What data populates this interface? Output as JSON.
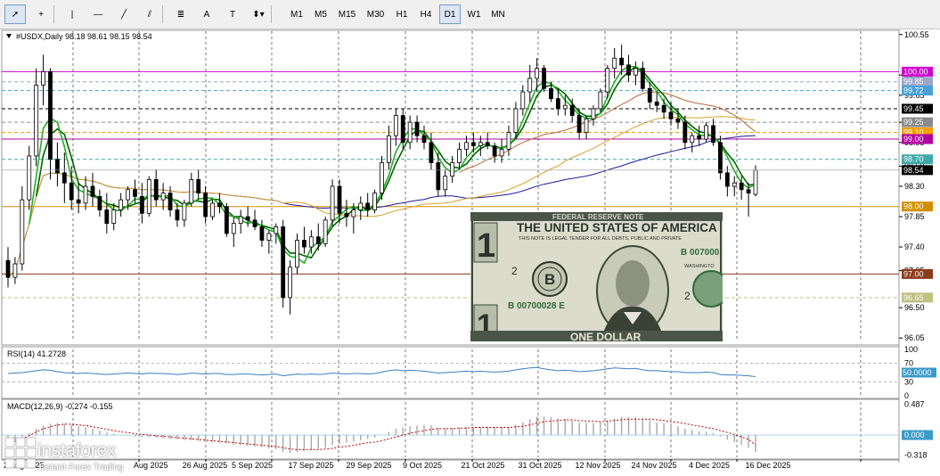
{
  "toolbar": {
    "tools": [
      {
        "name": "cursor-icon",
        "glyph": "➚",
        "selected": true
      },
      {
        "name": "crosshair-icon",
        "glyph": "+"
      },
      {
        "name": "vertical-line-icon",
        "glyph": "|"
      },
      {
        "name": "horizontal-line-icon",
        "glyph": "—"
      },
      {
        "name": "trendline-icon",
        "glyph": "╱"
      },
      {
        "name": "equidistant-channel-icon",
        "glyph": "⫽"
      },
      {
        "name": "fibonacci-icon",
        "glyph": "≣"
      },
      {
        "name": "text-icon",
        "glyph": "A"
      },
      {
        "name": "text-label-icon",
        "glyph": "T"
      },
      {
        "name": "arrows-icon",
        "glyph": "⬍▾"
      }
    ],
    "timeframes": [
      "M1",
      "M5",
      "M15",
      "M30",
      "H1",
      "H4",
      "D1",
      "W1",
      "MN"
    ],
    "active_timeframe": "D1"
  },
  "chart_data": [
    {
      "type": "candlestick",
      "title": "#USDX,Daily",
      "ohlc_header": "98.18 98.61 98.15 98.54",
      "x_labels": [
        "26 Aug 2025",
        "5 Sep 2025",
        "17 Sep 2025",
        "29 Sep 2025",
        "9 Oct 2025",
        "21 Oct 2025",
        "31 Oct 2025",
        "12 Nov 2025",
        "24 Nov 2025",
        "4 Dec 2025",
        "16 Dec 2025"
      ],
      "x_partial_labels": [
        "2 Aug 2025",
        "Aug 2025"
      ],
      "y_ticks": [
        100.55,
        99.95,
        99.65,
        99.25,
        98.95,
        98.6,
        98.3,
        97.85,
        97.4,
        97.05,
        96.5,
        96.05
      ],
      "ylim": [
        96.0,
        100.6
      ],
      "price_levels": [
        {
          "value": 100.0,
          "label": "100.00",
          "color": "#d000d0",
          "style": "solid"
        },
        {
          "value": 99.85,
          "label": "99.85",
          "color": "#9aa6c8",
          "style": "dashed"
        },
        {
          "value": 99.72,
          "label": "99.72",
          "color": "#4aa0d8",
          "style": "dashed"
        },
        {
          "value": 99.45,
          "label": "99.45",
          "color": "#000000",
          "style": "dashed"
        },
        {
          "value": 99.25,
          "label": "99.25",
          "color": "#8a8a8a",
          "style": "dashed"
        },
        {
          "value": 99.1,
          "label": "99.10",
          "color": "#f0a000",
          "style": "dashed"
        },
        {
          "value": 99.0,
          "label": "99.00",
          "color": "#b000a0",
          "style": "solid"
        },
        {
          "value": 98.7,
          "label": "98.70",
          "color": "#40a8a8",
          "style": "dashed"
        },
        {
          "value": 98.0,
          "label": "98.00",
          "color": "#d09000",
          "style": "solid"
        },
        {
          "value": 97.0,
          "label": "97.00",
          "color": "#8b3a1a",
          "style": "solid"
        },
        {
          "value": 96.65,
          "label": "96.65",
          "color": "#c0c080",
          "style": "dashed"
        }
      ],
      "current_price": {
        "value": 98.54,
        "label": "98.54",
        "color": "#000000"
      },
      "candles": [
        [
          97.2,
          97.4,
          96.8,
          96.95
        ],
        [
          96.95,
          97.25,
          96.85,
          97.15
        ],
        [
          97.15,
          98.3,
          97.05,
          98.1
        ],
        [
          98.1,
          98.9,
          97.95,
          98.75
        ],
        [
          98.75,
          100.05,
          98.6,
          99.8
        ],
        [
          99.8,
          100.25,
          99.5,
          100.0
        ],
        [
          100.0,
          100.05,
          98.4,
          98.7
        ],
        [
          98.7,
          98.95,
          98.3,
          98.5
        ],
        [
          98.5,
          98.8,
          98.05,
          98.35
        ],
        [
          98.35,
          98.6,
          97.95,
          98.1
        ],
        [
          98.1,
          98.35,
          97.9,
          98.05
        ],
        [
          98.05,
          98.45,
          97.95,
          98.3
        ],
        [
          98.3,
          98.5,
          98.0,
          98.15
        ],
        [
          98.15,
          98.25,
          97.85,
          97.95
        ],
        [
          97.95,
          98.2,
          97.6,
          97.75
        ],
        [
          97.75,
          98.05,
          97.65,
          97.95
        ],
        [
          97.95,
          98.2,
          97.85,
          98.1
        ],
        [
          98.1,
          98.3,
          97.95,
          98.25
        ],
        [
          98.25,
          98.4,
          98.05,
          98.15
        ],
        [
          98.15,
          98.35,
          97.75,
          97.9
        ],
        [
          97.9,
          98.45,
          97.85,
          98.4
        ],
        [
          98.4,
          98.55,
          98.0,
          98.1
        ],
        [
          98.1,
          98.35,
          97.95,
          98.2
        ],
        [
          98.2,
          98.3,
          97.85,
          97.95
        ],
        [
          97.95,
          98.05,
          97.7,
          97.8
        ],
        [
          97.8,
          98.1,
          97.7,
          98.05
        ],
        [
          98.05,
          98.5,
          98.0,
          98.4
        ],
        [
          98.4,
          98.55,
          98.1,
          98.2
        ],
        [
          98.2,
          98.3,
          97.75,
          97.85
        ],
        [
          97.85,
          98.1,
          97.8,
          98.05
        ],
        [
          98.05,
          98.2,
          97.9,
          98.0
        ],
        [
          98.0,
          98.05,
          97.55,
          97.6
        ],
        [
          97.6,
          97.85,
          97.4,
          97.75
        ],
        [
          97.75,
          97.95,
          97.6,
          97.85
        ],
        [
          97.85,
          98.0,
          97.7,
          97.8
        ],
        [
          97.8,
          97.95,
          97.65,
          97.7
        ],
        [
          97.7,
          97.8,
          97.4,
          97.5
        ],
        [
          97.5,
          97.65,
          97.3,
          97.6
        ],
        [
          97.6,
          97.75,
          97.45,
          97.7
        ],
        [
          97.7,
          97.8,
          96.5,
          96.65
        ],
        [
          96.65,
          97.2,
          96.4,
          97.1
        ],
        [
          97.1,
          97.6,
          97.0,
          97.5
        ],
        [
          97.5,
          97.7,
          97.3,
          97.4
        ],
        [
          97.4,
          97.65,
          97.3,
          97.55
        ],
        [
          97.55,
          97.75,
          97.35,
          97.45
        ],
        [
          97.45,
          97.85,
          97.4,
          97.8
        ],
        [
          97.8,
          98.4,
          97.7,
          98.3
        ],
        [
          98.3,
          98.4,
          97.75,
          97.9
        ],
        [
          97.9,
          98.1,
          97.7,
          97.85
        ],
        [
          97.85,
          98.05,
          97.6,
          97.95
        ],
        [
          97.95,
          98.15,
          97.8,
          98.05
        ],
        [
          98.05,
          98.2,
          97.85,
          97.95
        ],
        [
          97.95,
          98.25,
          97.9,
          98.2
        ],
        [
          98.2,
          98.75,
          98.1,
          98.65
        ],
        [
          98.65,
          99.2,
          98.55,
          99.05
        ],
        [
          99.05,
          99.45,
          98.9,
          99.35
        ],
        [
          99.35,
          99.45,
          98.85,
          98.95
        ],
        [
          98.95,
          99.35,
          98.85,
          99.25
        ],
        [
          99.25,
          99.35,
          98.95,
          99.05
        ],
        [
          99.05,
          99.2,
          98.85,
          98.95
        ],
        [
          98.95,
          99.1,
          98.55,
          98.65
        ],
        [
          98.65,
          98.8,
          98.15,
          98.25
        ],
        [
          98.25,
          98.55,
          98.15,
          98.45
        ],
        [
          98.45,
          98.75,
          98.35,
          98.65
        ],
        [
          98.65,
          98.95,
          98.55,
          98.85
        ],
        [
          98.85,
          99.05,
          98.75,
          98.95
        ],
        [
          98.95,
          99.1,
          98.8,
          98.9
        ],
        [
          98.9,
          99.05,
          98.75,
          98.95
        ],
        [
          98.95,
          99.1,
          98.85,
          98.9
        ],
        [
          98.9,
          98.95,
          98.65,
          98.75
        ],
        [
          98.75,
          99.0,
          98.65,
          98.85
        ],
        [
          98.85,
          99.2,
          98.75,
          99.1
        ],
        [
          99.1,
          99.55,
          99.0,
          99.45
        ],
        [
          99.45,
          99.8,
          99.35,
          99.7
        ],
        [
          99.7,
          100.1,
          99.55,
          99.9
        ],
        [
          99.9,
          100.2,
          99.7,
          100.05
        ],
        [
          100.05,
          100.1,
          99.7,
          99.75
        ],
        [
          99.75,
          99.85,
          99.55,
          99.6
        ],
        [
          99.6,
          99.75,
          99.35,
          99.45
        ],
        [
          99.45,
          99.65,
          99.35,
          99.5
        ],
        [
          99.5,
          99.6,
          99.25,
          99.35
        ],
        [
          99.35,
          99.45,
          99.0,
          99.1
        ],
        [
          99.1,
          99.35,
          99.0,
          99.3
        ],
        [
          99.3,
          99.5,
          99.2,
          99.45
        ],
        [
          99.45,
          99.75,
          99.4,
          99.7
        ],
        [
          99.7,
          100.1,
          99.6,
          100.05
        ],
        [
          100.05,
          100.35,
          99.9,
          100.2
        ],
        [
          100.2,
          100.4,
          99.95,
          100.1
        ],
        [
          100.1,
          100.25,
          99.85,
          99.95
        ],
        [
          99.95,
          100.15,
          99.8,
          100.05
        ],
        [
          100.05,
          100.15,
          99.7,
          99.75
        ],
        [
          99.75,
          99.85,
          99.45,
          99.55
        ],
        [
          99.55,
          99.7,
          99.4,
          99.5
        ],
        [
          99.5,
          99.6,
          99.3,
          99.4
        ],
        [
          99.4,
          99.55,
          99.2,
          99.3
        ],
        [
          99.3,
          99.45,
          99.15,
          99.25
        ],
        [
          99.25,
          99.35,
          98.85,
          98.95
        ],
        [
          98.95,
          99.1,
          98.8,
          99.05
        ],
        [
          99.05,
          99.2,
          98.9,
          99.0
        ],
        [
          99.0,
          99.25,
          98.95,
          99.2
        ],
        [
          99.2,
          99.3,
          98.9,
          98.95
        ],
        [
          98.95,
          99.05,
          98.4,
          98.5
        ],
        [
          98.5,
          98.6,
          98.15,
          98.3
        ],
        [
          98.3,
          98.45,
          98.15,
          98.35
        ],
        [
          98.35,
          98.45,
          98.1,
          98.25
        ],
        [
          98.25,
          98.35,
          97.85,
          98.2
        ],
        [
          98.18,
          98.61,
          98.15,
          98.54
        ]
      ],
      "indicators": [
        {
          "name": "MA slow (blue)",
          "color": "#1c1c9a"
        },
        {
          "name": "MA medium (orange)",
          "color": "#d8a030"
        },
        {
          "name": "MA brown",
          "color": "#b86a3a"
        },
        {
          "name": "MA dark green",
          "color": "#006400"
        },
        {
          "name": "MA light green",
          "color": "#22b022"
        }
      ]
    },
    {
      "type": "line",
      "title": "RSI(14) 41.2728",
      "y_ticks": [
        100,
        70,
        50.0,
        30,
        0
      ],
      "ylim": [
        0,
        100
      ],
      "color": "#3a7ec0",
      "values": [
        48,
        49,
        50,
        52,
        54,
        56,
        55,
        52,
        50,
        49,
        48,
        49,
        48,
        47,
        46,
        47,
        48,
        49,
        48,
        47,
        49,
        48,
        48,
        47,
        46,
        47,
        49,
        48,
        47,
        48,
        48,
        46,
        46,
        47,
        47,
        46,
        45,
        46,
        47,
        43,
        45,
        47,
        46,
        47,
        46,
        47,
        49,
        48,
        47,
        48,
        48,
        47,
        48,
        51,
        54,
        56,
        54,
        55,
        54,
        53,
        51,
        49,
        50,
        51,
        52,
        53,
        52,
        53,
        52,
        51,
        52,
        53,
        56,
        58,
        60,
        61,
        58,
        56,
        54,
        55,
        54,
        52,
        53,
        54,
        56,
        58,
        60,
        59,
        58,
        59,
        56,
        54,
        54,
        53,
        52,
        52,
        50,
        50,
        50,
        51,
        50,
        46,
        45,
        45,
        44,
        43,
        41.27
      ]
    },
    {
      "type": "bar",
      "title": "MACD(12,26,9) -0.274 -0.155",
      "y_ticks": [
        0.487,
        0.0,
        -0.318
      ],
      "ylim": [
        -0.35,
        0.52
      ],
      "values": [
        -0.1,
        -0.08,
        -0.03,
        0.03,
        0.1,
        0.15,
        0.18,
        0.19,
        0.18,
        0.16,
        0.14,
        0.12,
        0.1,
        0.07,
        0.04,
        0.02,
        0.0,
        -0.01,
        -0.02,
        -0.03,
        -0.03,
        -0.04,
        -0.05,
        -0.06,
        -0.07,
        -0.08,
        -0.08,
        -0.09,
        -0.1,
        -0.11,
        -0.12,
        -0.13,
        -0.15,
        -0.16,
        -0.17,
        -0.18,
        -0.19,
        -0.21,
        -0.22,
        -0.26,
        -0.28,
        -0.27,
        -0.25,
        -0.24,
        -0.22,
        -0.2,
        -0.16,
        -0.14,
        -0.12,
        -0.1,
        -0.08,
        -0.06,
        -0.04,
        0.0,
        0.05,
        0.1,
        0.12,
        0.14,
        0.15,
        0.16,
        0.15,
        0.12,
        0.11,
        0.11,
        0.12,
        0.13,
        0.13,
        0.13,
        0.13,
        0.12,
        0.12,
        0.13,
        0.16,
        0.2,
        0.25,
        0.29,
        0.29,
        0.28,
        0.26,
        0.25,
        0.23,
        0.2,
        0.19,
        0.19,
        0.2,
        0.23,
        0.26,
        0.28,
        0.28,
        0.28,
        0.26,
        0.23,
        0.2,
        0.18,
        0.16,
        0.14,
        0.1,
        0.08,
        0.06,
        0.05,
        0.03,
        -0.02,
        -0.07,
        -0.11,
        -0.15,
        -0.2,
        -0.27
      ],
      "signal": [
        -0.12,
        -0.1,
        -0.06,
        -0.01,
        0.05,
        0.1,
        0.13,
        0.16,
        0.17,
        0.17,
        0.16,
        0.15,
        0.13,
        0.11,
        0.09,
        0.07,
        0.05,
        0.04,
        0.02,
        0.01,
        0.0,
        -0.01,
        -0.02,
        -0.03,
        -0.04,
        -0.05,
        -0.06,
        -0.07,
        -0.08,
        -0.09,
        -0.1,
        -0.11,
        -0.12,
        -0.13,
        -0.14,
        -0.15,
        -0.16,
        -0.17,
        -0.18,
        -0.2,
        -0.22,
        -0.23,
        -0.23,
        -0.23,
        -0.23,
        -0.22,
        -0.21,
        -0.19,
        -0.18,
        -0.16,
        -0.14,
        -0.12,
        -0.11,
        -0.09,
        -0.06,
        -0.03,
        0.0,
        0.03,
        0.05,
        0.07,
        0.09,
        0.1,
        0.1,
        0.1,
        0.11,
        0.11,
        0.12,
        0.12,
        0.12,
        0.12,
        0.12,
        0.12,
        0.13,
        0.14,
        0.16,
        0.19,
        0.21,
        0.22,
        0.23,
        0.24,
        0.24,
        0.23,
        0.22,
        0.22,
        0.21,
        0.22,
        0.23,
        0.24,
        0.25,
        0.25,
        0.25,
        0.25,
        0.24,
        0.23,
        0.21,
        0.2,
        0.18,
        0.16,
        0.14,
        0.12,
        0.1,
        0.07,
        0.04,
        0.01,
        -0.03,
        -0.07,
        -0.155
      ],
      "hist_color": "#a8a8a8",
      "signal_color": "#c00000"
    }
  ],
  "branding": {
    "name": "instaforex",
    "tagline": "Instant Forex Trading"
  },
  "banknote": {
    "header": "FEDERAL RESERVE NOTE",
    "country": "THE UNITED STATES OF AMERICA",
    "serial": "B 00700028 E",
    "serial_partial": "B 007000",
    "legal": "THIS NOTE IS LEGAL TENDER FOR ALL DEBTS, PUBLIC AND PRIVATE",
    "district_letter": "B",
    "denomination": "1",
    "denomination_small": "2",
    "value_text": "ONE DOLLAR",
    "name_partial": "WASHINGTO"
  },
  "colors": {
    "grid": "#555555",
    "up": "#ffffff",
    "down": "#000000",
    "panel_bg": "#ffffff"
  }
}
